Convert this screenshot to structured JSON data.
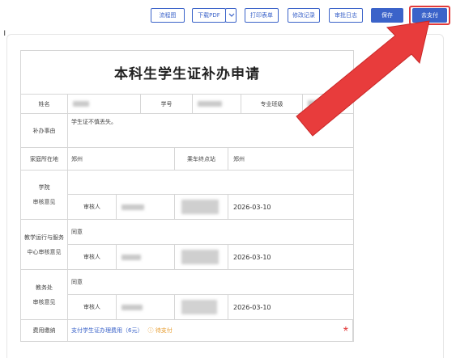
{
  "toolbar": {
    "flowchart": "流程图",
    "download_pdf": "下载PDF",
    "print_form": "打印表单",
    "modify_record": "修改记录",
    "audit_log": "审批日志",
    "save": "保存",
    "pay": "去支付"
  },
  "form": {
    "title": "本科生学生证补办申请",
    "labels": {
      "name": "姓名",
      "student_id": "学号",
      "major_class": "专业班级",
      "reason": "补办事由",
      "home": "家庭所在地",
      "station": "乘车终点站",
      "college_opinion": [
        "学院",
        "审核意见"
      ],
      "teaching_center_opinion": [
        "教学运行与服务",
        "中心审核意见"
      ],
      "academic_office_opinion": [
        "教务处",
        "审核意见"
      ],
      "reviewer": "审核人",
      "fee": "费用缴纳"
    },
    "values": {
      "reason": "学生证不慎丢失。",
      "home": "郑州",
      "station": "郑州",
      "college_date": "2026-03-10",
      "teaching_center_comment": "同意",
      "teaching_center_date": "2026-03-10",
      "academic_office_comment": "同意",
      "academic_office_date": "2026-03-10",
      "fee_link": "支付学生证办理费用（6元）",
      "fee_status": "ⓘ 待支付",
      "required_mark": "*"
    }
  },
  "colors": {
    "primary": "#3b63c9",
    "highlight": "#e23a3a",
    "pending": "#e69a2a"
  }
}
